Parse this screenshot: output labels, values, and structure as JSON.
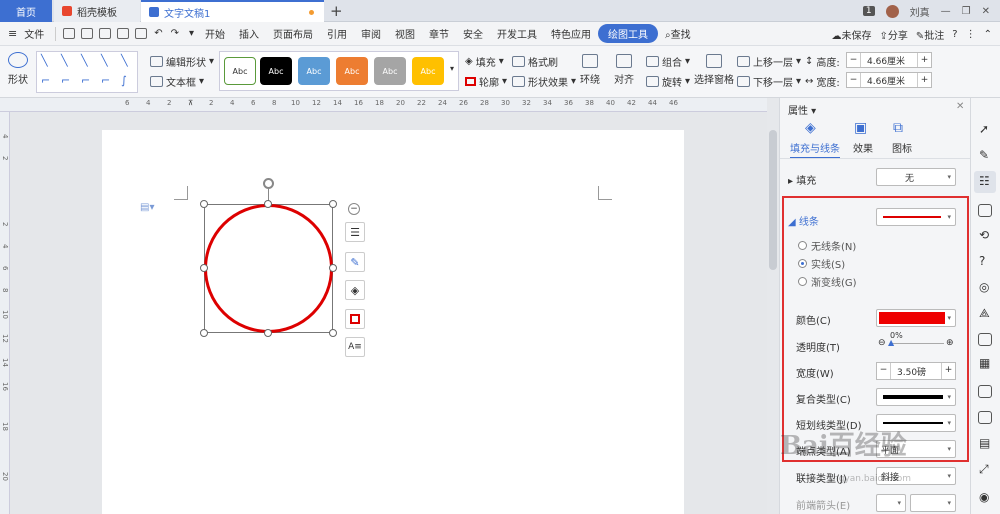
{
  "tabs": {
    "home": "首页",
    "template": "稻壳模板",
    "doc": "文字文稿1",
    "page_badge": "1",
    "user": "刘真"
  },
  "menu": {
    "file": "文件",
    "items": [
      "开始",
      "插入",
      "页面布局",
      "引用",
      "审阅",
      "视图",
      "章节",
      "安全",
      "开发工具",
      "特色应用"
    ],
    "draw_tool": "绘图工具",
    "search": "查找",
    "unsaved": "未保存",
    "share": "分享",
    "annotate": "批注",
    "help": "?"
  },
  "ribbon": {
    "shape": "形状",
    "edit_shape": "编辑形状",
    "text_box": "文本框",
    "style_label": "Abc",
    "fill": "填充",
    "format_painter": "格式刷",
    "outline": "轮廓",
    "shape_effect": "形状效果",
    "wrap": "环绕",
    "align": "对齐",
    "group": "组合",
    "rotate": "旋转",
    "selection_pane": "选择窗格",
    "bring_forward": "上移一层",
    "send_backward": "下移一层",
    "height_label": "高度:",
    "height_value": "4.66厘米",
    "width_label": "宽度:",
    "width_value": "4.66厘米"
  },
  "ruler": {
    "h": [
      "6",
      "4",
      "2",
      "",
      "2",
      "4",
      "6",
      "8",
      "10",
      "12",
      "14",
      "16",
      "18",
      "20",
      "22",
      "24",
      "26",
      "28",
      "30",
      "32",
      "34",
      "36",
      "38",
      "40",
      "42",
      "44",
      "46"
    ],
    "v": [
      "4",
      "2",
      "",
      "2",
      "4",
      "6",
      "8",
      "10",
      "12",
      "14",
      "16",
      "18",
      "20"
    ]
  },
  "panel": {
    "title": "属性",
    "tab_fill": "填充与线条",
    "tab_effect": "效果",
    "tab_icon": "图标",
    "fill_label": "填充",
    "fill_value": "无",
    "line_label": "线条",
    "no_line": "无线条(N)",
    "solid_line": "实线(S)",
    "gradient_line": "渐变线(G)",
    "color_label": "颜色(C)",
    "transparency_label": "透明度(T)",
    "transparency_value": "0%",
    "width_label": "宽度(W)",
    "width_value": "3.50磅",
    "compound_label": "复合类型(C)",
    "dash_label": "短划线类型(D)",
    "cap_label": "端点类型(A)",
    "cap_value": "平面",
    "join_label": "联接类型(J)",
    "join_value": "斜接",
    "arrow_label": "前端箭头(E)",
    "line_color": "#ee0000"
  },
  "watermark": {
    "main": "Bai百经验",
    "sub": "jingyan.baidu.com"
  }
}
